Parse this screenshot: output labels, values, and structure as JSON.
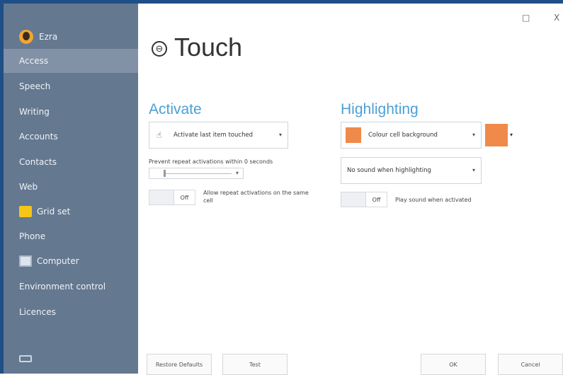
{
  "window": {
    "maximize_icon": "□",
    "close_icon": "X"
  },
  "sidebar": {
    "user": "Ezra",
    "items": [
      {
        "label": "Access",
        "selected": true
      },
      {
        "label": "Speech"
      },
      {
        "label": "Writing"
      },
      {
        "label": "Accounts"
      },
      {
        "label": "Contacts"
      },
      {
        "label": "Web"
      },
      {
        "label": "Grid set",
        "icon": "grid-set-icon"
      },
      {
        "label": "Phone"
      },
      {
        "label": "Computer",
        "icon": "computer-icon"
      },
      {
        "label": "Environment control"
      },
      {
        "label": "Licences"
      }
    ],
    "bottom_icon": "keyboard-icon"
  },
  "header": {
    "back_icon": "⊖",
    "title": "Touch"
  },
  "activate": {
    "title": "Activate",
    "dropdown_value": "Activate last item touched",
    "repeat_label": "Prevent repeat activations within 0 seconds",
    "slider_value": 0,
    "toggle_state": "Off",
    "toggle_label": "Allow repeat activations on the same cell"
  },
  "highlighting": {
    "title": "Highlighting",
    "dropdown_value": "Colour cell background",
    "swatch_color": "#f08a4b",
    "sound_dropdown_value": "No sound when highlighting",
    "toggle_state": "Off",
    "toggle_label": "Play sound when activated"
  },
  "footer": {
    "restore_label": "Restore Defaults",
    "test_label": "Test",
    "ok_label": "OK",
    "cancel_label": "Cancel"
  },
  "colors": {
    "sidebar": "#647890",
    "selected": "#8291a6",
    "accent": "#4aa0d6",
    "frame": "#1f4f86"
  }
}
